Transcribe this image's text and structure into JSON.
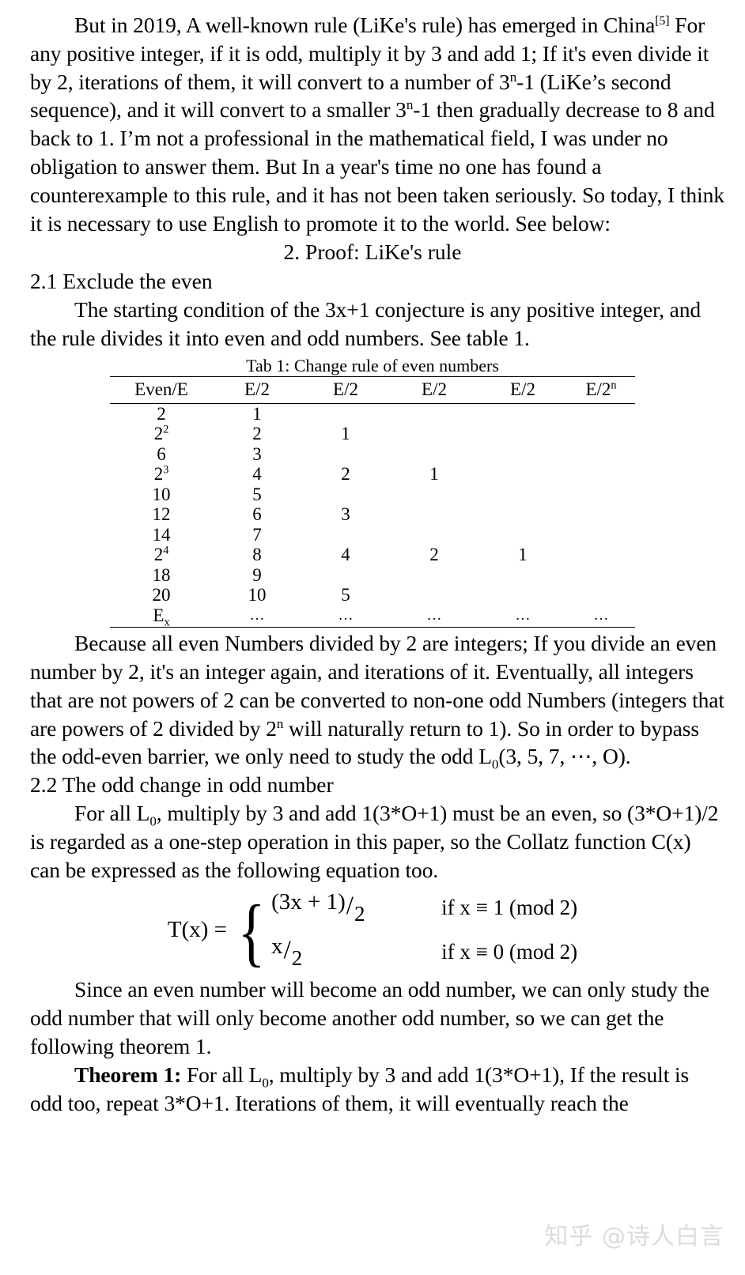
{
  "document": {
    "paragraphs": {
      "intro_line1": "But in 2019, A well-known rule (LiKe's rule) has emerged in China",
      "intro_citation": "[5]",
      "intro_rest_a": "For any positive integer, if it is odd, multiply it by 3 and add 1; If it's even divide it by 2, iterations of them, it will convert to a number of 3",
      "intro_sup_n1": "n",
      "intro_rest_b": "-1 (LiKe’s second sequence), and it will convert to a smaller 3",
      "intro_sup_n2": "n",
      "intro_rest_c": "-1 then gradually decrease to 8 and back to 1. I’m not a professional in the mathematical field, I was under no obligation to answer them. But In a year's time no one has found a counterexample to this rule, and it has not been taken seriously. So today, I think it is necessary to use English to promote it to the world. See below:",
      "section_2_title": "2. Proof: LiKe's rule",
      "section_2_1_title": "2.1 Exclude the even",
      "section_2_1_body": "The starting condition of the 3x+1 conjecture is any positive integer, and the rule divides it into even and odd numbers. See table 1.",
      "after_table_a": "Because all even Numbers divided by 2 are integers; If you divide an even number by 2, it's an integer again, and iterations of it. Eventually, all integers that are not powers of 2 can be converted to non-one odd Numbers (integers that are powers of 2 divided by 2",
      "after_table_sup_n": "n",
      "after_table_b": " will naturally return to 1). So in order to bypass the odd-even barrier, we only need to study the odd L",
      "after_table_sub_0": "0",
      "after_table_c": "(3, 5, 7, ⋯, O).",
      "section_2_2_title": "2.2 The odd change in odd number",
      "section_2_2_a": "For all L",
      "section_2_2_sub_0": "0",
      "section_2_2_b": ", multiply by 3 and add 1(3*O+1) must be an even, so (3*O+1)/2 is regarded as a one-step operation in this paper, so the Collatz function C(x) can be expressed as the following equation too.",
      "after_eq_body": "Since an even number will become an odd number, we can only study the odd number that will only become another odd number, so we can get the following theorem 1.",
      "theorem_label": "Theorem 1:",
      "theorem_a": " For all L",
      "theorem_sub_0": "0",
      "theorem_b": ", multiply by 3 and add 1(3*O+1), If the result is odd too, repeat 3*O+1. Iterations of them, it will eventually reach the"
    },
    "table": {
      "caption": "Tab 1: Change rule of even numbers",
      "headers": [
        "Even/E",
        "E/2",
        "E/2",
        "E/2",
        "E/2",
        "E/2"
      ],
      "header_last_sup": "n",
      "rows": [
        {
          "cells": [
            "2",
            "1",
            "",
            "",
            "",
            ""
          ],
          "sup0": ""
        },
        {
          "cells": [
            "2",
            "2",
            "1",
            "",
            "",
            ""
          ],
          "sup0": "2"
        },
        {
          "cells": [
            "6",
            "3",
            "",
            "",
            "",
            ""
          ],
          "sup0": ""
        },
        {
          "cells": [
            "2",
            "4",
            "2",
            "1",
            "",
            ""
          ],
          "sup0": "3"
        },
        {
          "cells": [
            "10",
            "5",
            "",
            "",
            "",
            ""
          ],
          "sup0": ""
        },
        {
          "cells": [
            "12",
            "6",
            "3",
            "",
            "",
            ""
          ],
          "sup0": ""
        },
        {
          "cells": [
            "14",
            "7",
            "",
            "",
            "",
            ""
          ],
          "sup0": ""
        },
        {
          "cells": [
            "2",
            "8",
            "4",
            "2",
            "1",
            ""
          ],
          "sup0": "4"
        },
        {
          "cells": [
            "18",
            "9",
            "",
            "",
            "",
            ""
          ],
          "sup0": ""
        },
        {
          "cells": [
            "20",
            "10",
            "5",
            "",
            "",
            ""
          ],
          "sup0": ""
        }
      ],
      "last_row": {
        "label": "E",
        "label_sub": "x",
        "ellipses": [
          "…",
          "…",
          "…",
          "…",
          "…"
        ]
      }
    },
    "equation": {
      "lhs": "T(x) =",
      "row1_numerator": "(3x + 1)",
      "row1_slash": "/",
      "row1_denominator": "2",
      "row1_condition": "if x ≡ 1 (mod 2)",
      "row2_numerator": "x",
      "row2_slash": "/",
      "row2_denominator": "2",
      "row2_condition": "if x ≡ 0 (mod 2)"
    },
    "watermark": {
      "text": "知乎 @诗人白言",
      "color": "#dcdcdc"
    }
  }
}
